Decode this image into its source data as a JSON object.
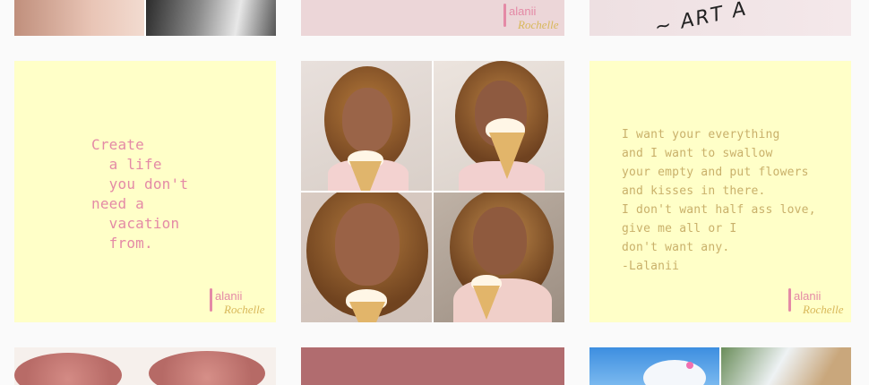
{
  "grid": {
    "row1": {
      "left_alt": "",
      "middle_watermark": {
        "line1": "alanii",
        "line2": "Rochelle"
      },
      "right_text": "~ ART A"
    },
    "row2": {
      "left_quote": {
        "text": "Create\n  a life\n  you don't\nneed a\n  vacation\n  from.",
        "watermark": {
          "line1": "alanii",
          "line2": "Rochelle"
        }
      },
      "right_quote": {
        "text": "I want your everything\nand I want to swallow\nyour empty and put flowers\nand kisses in there.\nI don't want half ass love,\ngive me all or I\ndon't want any.\n-Lalanii",
        "watermark": {
          "line1": "alanii",
          "line2": "Rochelle"
        }
      }
    }
  },
  "colors": {
    "page_bg": "#fafafa",
    "quote_bg": "#ffffc8",
    "quote_pink": "#e48aa6",
    "quote_gold": "#c9b06a",
    "blush_tile": "#ecd6d8",
    "mauve_tile": "#b16c6f"
  },
  "icons": {
    "watermark": "lalanii-rochelle-logo"
  }
}
